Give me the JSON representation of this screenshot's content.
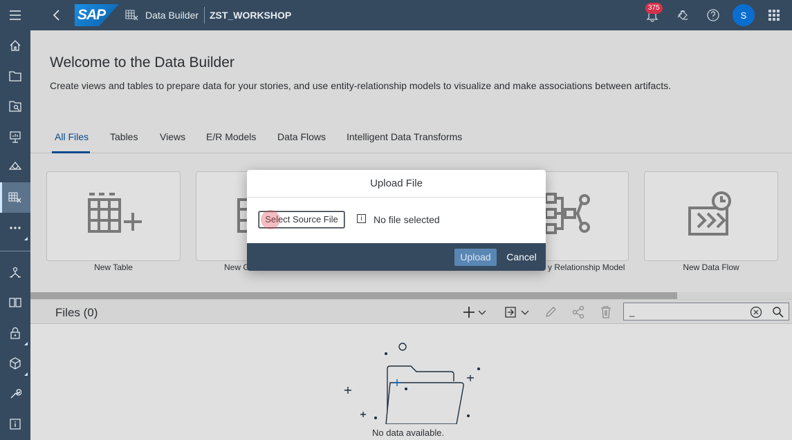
{
  "shell": {
    "logo": "SAP",
    "app_name": "Data Builder",
    "space_name": "ZST_WORKSHOP",
    "notifications_count": "375",
    "avatar_initial": "S"
  },
  "rail": {
    "items": [
      "menu-icon",
      "home-icon",
      "repository-icon",
      "catalog-icon",
      "stories-icon",
      "modeler-icon",
      "data-builder-icon",
      "more-icon",
      "data-integration-icon",
      "business-builder-icon",
      "security-icon",
      "space-management-icon",
      "system-icon",
      "about-icon"
    ]
  },
  "page": {
    "title": "Welcome to the Data Builder",
    "subtitle": "Create views and tables to prepare data for your stories, and use entity-relationship models to visualize and make associations between artifacts."
  },
  "tabs": [
    "All Files",
    "Tables",
    "Views",
    "E/R Models",
    "Data Flows",
    "Intelligent Data Transforms"
  ],
  "tiles": [
    {
      "label": "New Table"
    },
    {
      "label": "New Gr"
    },
    {
      "label": "y Relationship Model"
    },
    {
      "label": "New Data Flow"
    }
  ],
  "files": {
    "title": "Files (0)",
    "search_value": "_",
    "empty_text": "No data available."
  },
  "dialog": {
    "title": "Upload File",
    "select_label": "Select Source File",
    "status": "No file selected",
    "upload_label": "Upload",
    "cancel_label": "Cancel"
  },
  "colors": {
    "shell": "#354a5f",
    "accent": "#0854a0",
    "badge": "#d5324a",
    "avatar": "#0a6ed1"
  }
}
